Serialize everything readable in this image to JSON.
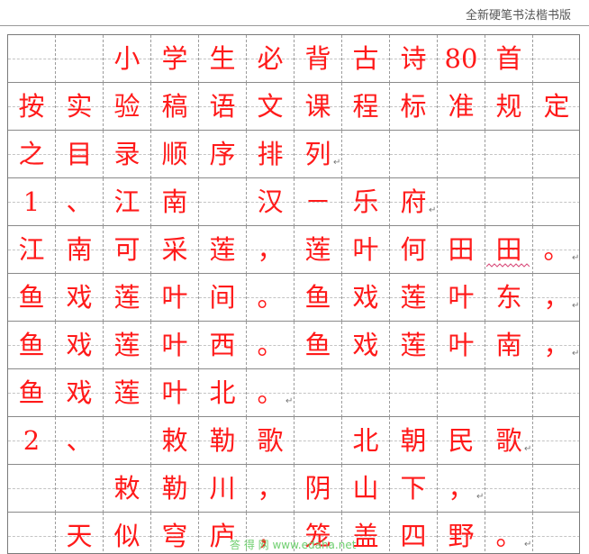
{
  "header": {
    "title": "全新硬笔书法楷书版"
  },
  "grid": {
    "rows": [
      [
        "",
        "",
        "小",
        "学",
        "生",
        "必",
        "背",
        "古",
        "诗",
        "80",
        "首",
        ""
      ],
      [
        "按",
        "实",
        "验",
        "稿",
        "语",
        "文",
        "课",
        "程",
        "标",
        "准",
        "规",
        "定"
      ],
      [
        "之",
        "目",
        "录",
        "顺",
        "序",
        "排",
        "列",
        "",
        "",
        "",
        "",
        ""
      ],
      [
        "1",
        "、",
        "江",
        "南",
        "",
        "汉",
        "－",
        "乐",
        "府",
        "",
        "",
        ""
      ],
      [
        "江",
        "南",
        "可",
        "采",
        "莲",
        "，",
        "莲",
        "叶",
        "何",
        "田",
        "田",
        "。"
      ],
      [
        "鱼",
        "戏",
        "莲",
        "叶",
        "间",
        "。",
        "鱼",
        "戏",
        "莲",
        "叶",
        "东",
        "，"
      ],
      [
        "鱼",
        "戏",
        "莲",
        "叶",
        "西",
        "。",
        "鱼",
        "戏",
        "莲",
        "叶",
        "南",
        "，"
      ],
      [
        "鱼",
        "戏",
        "莲",
        "叶",
        "北",
        "。",
        "",
        "",
        "",
        "",
        "",
        ""
      ],
      [
        "2",
        "、",
        "",
        "敕",
        "勒",
        "歌",
        "",
        "北",
        "朝",
        "民",
        "歌",
        ""
      ],
      [
        "",
        "",
        "敕",
        "勒",
        "川",
        "，",
        "阴",
        "山",
        "下",
        "，",
        "",
        ""
      ],
      [
        "",
        "天",
        "似",
        "穹",
        "庐",
        "，",
        "笼",
        "盖",
        "四",
        "野",
        "。",
        ""
      ]
    ]
  },
  "paragraph_marks": [
    {
      "row": 2,
      "after_col": 6,
      "glyph": "↵"
    },
    {
      "row": 3,
      "after_col": 8,
      "glyph": "↵"
    },
    {
      "row": 4,
      "after_col": 11,
      "glyph": "↵"
    },
    {
      "row": 5,
      "after_col": 11,
      "glyph": "↵"
    },
    {
      "row": 6,
      "after_col": 11,
      "glyph": "↵"
    },
    {
      "row": 7,
      "after_col": 5,
      "glyph": "↵"
    },
    {
      "row": 8,
      "after_col": 10,
      "glyph": "↵"
    },
    {
      "row": 9,
      "after_col": 9,
      "glyph": "↵"
    },
    {
      "row": 10,
      "after_col": 10,
      "glyph": "↵"
    }
  ],
  "watermark": {
    "text": "答 得 网 www.edaha.net"
  },
  "colors": {
    "text": "#ff1a1a",
    "grid_line": "#8a8a8a",
    "watermark": "#6fcf6f"
  }
}
